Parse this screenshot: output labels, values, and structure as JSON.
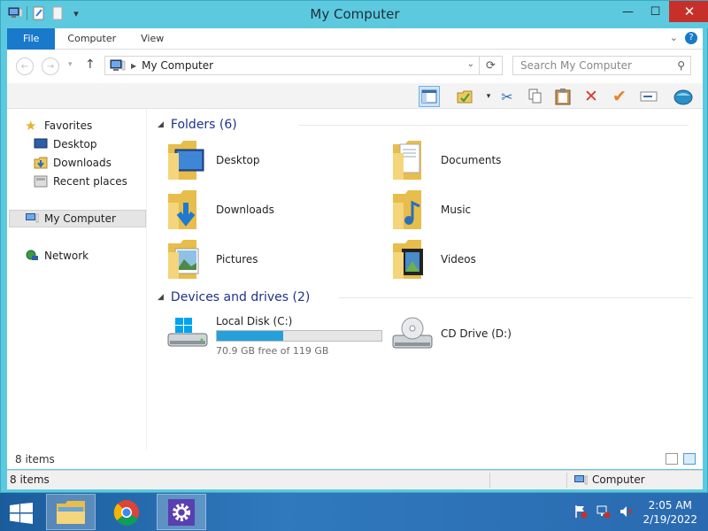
{
  "window": {
    "title": "My Computer",
    "controls": {
      "minimize": "—",
      "maximize": "☐",
      "close": "✕"
    }
  },
  "ribbon": {
    "tabs": [
      "File",
      "Computer",
      "View"
    ],
    "right_controls": {
      "collapse": "⌄",
      "help": "?"
    }
  },
  "address": {
    "location": "My Computer",
    "search_placeholder": "Search My Computer"
  },
  "toolbar": {
    "icons": [
      "preview-pane-icon",
      "properties-icon",
      "cut-icon",
      "copy-icon",
      "paste-icon",
      "delete-icon",
      "check-icon",
      "rename-icon",
      "globe-icon"
    ]
  },
  "nav": {
    "favorites": "Favorites",
    "desktop": "Desktop",
    "downloads": "Downloads",
    "recent": "Recent places",
    "my_computer": "My Computer",
    "network": "Network"
  },
  "folders": {
    "header": "Folders (6)",
    "items": [
      {
        "name": "Desktop",
        "icon": "desktop-folder-icon"
      },
      {
        "name": "Documents",
        "icon": "documents-folder-icon"
      },
      {
        "name": "Downloads",
        "icon": "downloads-folder-icon"
      },
      {
        "name": "Music",
        "icon": "music-folder-icon"
      },
      {
        "name": "Pictures",
        "icon": "pictures-folder-icon"
      },
      {
        "name": "Videos",
        "icon": "videos-folder-icon"
      }
    ]
  },
  "drives": {
    "header": "Devices and drives (2)",
    "local": {
      "name": "Local Disk (C:)",
      "free": "70.9 GB free of 119 GB",
      "used_fraction": 0.404
    },
    "cd": {
      "name": "CD Drive (D:)"
    }
  },
  "status": {
    "inner_count": "8 items",
    "outer_count": "8 items",
    "location": "Computer"
  },
  "taskbar": {
    "time": "2:05 AM",
    "date": "2/19/2022"
  },
  "colors": {
    "accent": "#1979ca",
    "chrome": "#5cc9df",
    "progress": "#26a0da",
    "close": "#c7302a"
  }
}
